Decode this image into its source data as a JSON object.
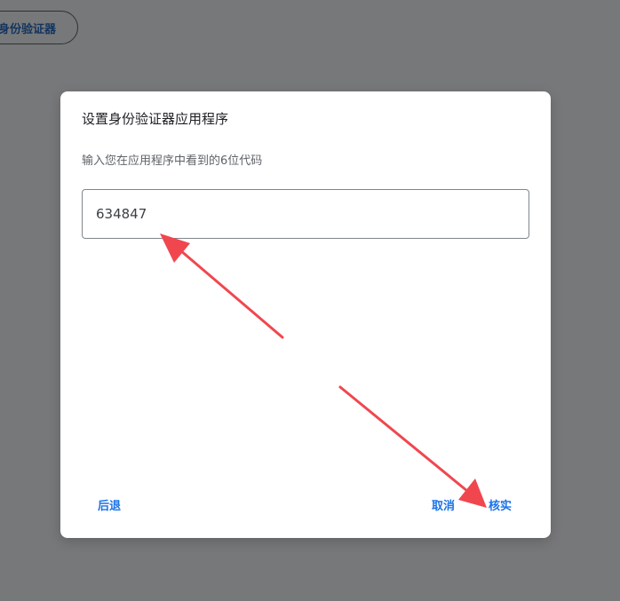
{
  "background": {
    "chip_label": "身份验证器"
  },
  "dialog": {
    "title": "设置身份验证器应用程序",
    "description": "输入您在应用程序中看到的6位代码",
    "code_value": "634847",
    "buttons": {
      "back": "后退",
      "cancel": "取消",
      "verify": "核实"
    }
  },
  "annotations": {
    "arrow_color": "#f0474f"
  },
  "colors": {
    "overlay": "#77787a",
    "dialog": "#ffffff",
    "link": "#1a73e8"
  }
}
